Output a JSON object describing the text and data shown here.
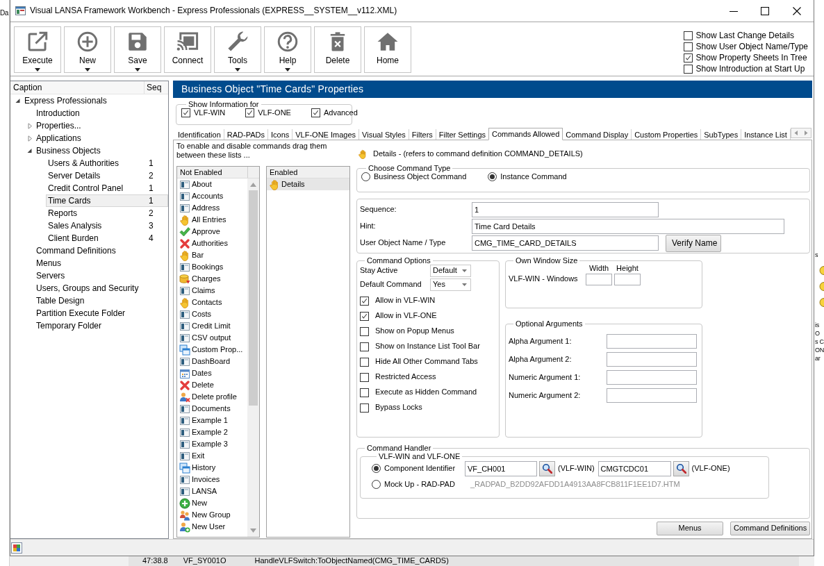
{
  "desktop": {
    "left_window_text": "Da",
    "right_window_fragments": [
      "s",
      "is",
      "O",
      "s C",
      "ON",
      "ar"
    ],
    "log_row": [
      "47:38.8",
      "VF_SY001O",
      "HandleVLFSwitch:ToObjectNamed(CMG_TIME_CARDS)"
    ]
  },
  "window": {
    "title": "Visual LANSA Framework Workbench - Express Professionals (EXPRESS__SYSTEM__v112.XML)"
  },
  "toolbar": [
    {
      "label": "Execute",
      "kind": "execute",
      "dropdown": true
    },
    {
      "label": "New",
      "kind": "new",
      "dropdown": true
    },
    {
      "label": "Save",
      "kind": "save",
      "dropdown": true
    },
    {
      "label": "Connect",
      "kind": "connect",
      "dropdown": false
    },
    {
      "label": "Tools",
      "kind": "tools",
      "dropdown": true
    },
    {
      "label": "Help",
      "kind": "help",
      "dropdown": true
    },
    {
      "label": "Delete",
      "kind": "delete",
      "dropdown": false
    },
    {
      "label": "Home",
      "kind": "home",
      "dropdown": false
    }
  ],
  "view_options": [
    {
      "label": "Show Last Change Details",
      "checked": false
    },
    {
      "label": "Show User Object Name/Type",
      "checked": false
    },
    {
      "label": "Show Property Sheets In Tree",
      "checked": true
    },
    {
      "label": "Show Introduction at Start Up",
      "checked": false
    }
  ],
  "tree": {
    "columns": [
      "Caption",
      "Seq"
    ],
    "items": [
      {
        "label": "Express Professionals",
        "expanded": true,
        "selected": false,
        "children": [
          {
            "label": "Introduction",
            "selected": false
          },
          {
            "label": "Properties...",
            "expanded": false,
            "selected": false
          },
          {
            "label": "Applications",
            "expanded": false,
            "selected": false
          },
          {
            "label": "Business Objects",
            "expanded": true,
            "selected": false,
            "children": [
              {
                "label": "Users & Authorities",
                "seq": "1",
                "selected": false
              },
              {
                "label": "Server Details",
                "seq": "2",
                "selected": false
              },
              {
                "label": "Credit Control Panel",
                "seq": "1",
                "selected": false
              },
              {
                "label": "Time Cards",
                "seq": "1",
                "selected": true
              },
              {
                "label": "Reports",
                "seq": "2",
                "selected": false
              },
              {
                "label": "Sales Analysis",
                "seq": "3",
                "selected": false
              },
              {
                "label": "Client Burden",
                "seq": "4",
                "selected": false
              }
            ]
          },
          {
            "label": "Command Definitions",
            "selected": false
          },
          {
            "label": "Menus",
            "selected": false
          },
          {
            "label": "Servers",
            "selected": false
          },
          {
            "label": "Users, Groups and Security",
            "selected": false
          },
          {
            "label": "Table Design",
            "selected": false
          },
          {
            "label": "Partition Execute Folder",
            "selected": false
          },
          {
            "label": "Temporary Folder",
            "selected": false
          }
        ]
      }
    ]
  },
  "panel": {
    "title": "Business Object \"Time Cards\" Properties",
    "show_information": {
      "legend": "Show Information for",
      "options": [
        {
          "label": "VLF-WIN",
          "checked": true
        },
        {
          "label": "VLF-ONE",
          "checked": true
        },
        {
          "label": "Advanced",
          "checked": true
        }
      ]
    },
    "tabs": [
      {
        "label": "Identification",
        "selected": false
      },
      {
        "label": "RAD-PADs",
        "selected": false
      },
      {
        "label": "Icons",
        "selected": false
      },
      {
        "label": "VLF-ONE Images",
        "selected": false
      },
      {
        "label": "Visual Styles",
        "selected": false
      },
      {
        "label": "Filters",
        "selected": false
      },
      {
        "label": "Filter Settings",
        "selected": false
      },
      {
        "label": "Commands Allowed",
        "selected": true
      },
      {
        "label": "Command Display",
        "selected": false
      },
      {
        "label": "Custom Properties",
        "selected": false
      },
      {
        "label": "SubTypes",
        "selected": false
      },
      {
        "label": "Instance List",
        "selected": false
      }
    ],
    "commands_allowed": {
      "instructions": "To enable and disable commands drag them between these lists ...",
      "not_enabled": {
        "header": "Not Enabled",
        "items": [
          {
            "label": "About",
            "kind": "window",
            "selected": false
          },
          {
            "label": "Accounts",
            "kind": "window",
            "selected": false
          },
          {
            "label": "Address",
            "kind": "window",
            "selected": false
          },
          {
            "label": "All Entries",
            "kind": "hand",
            "selected": false
          },
          {
            "label": "Approve",
            "kind": "check",
            "selected": false
          },
          {
            "label": "Authorities",
            "kind": "cross",
            "selected": false
          },
          {
            "label": "Bar",
            "kind": "hand",
            "selected": false
          },
          {
            "label": "Bookings",
            "kind": "window",
            "selected": false
          },
          {
            "label": "Charges",
            "kind": "coins",
            "selected": false
          },
          {
            "label": "Claims",
            "kind": "window",
            "selected": false
          },
          {
            "label": "Contacts",
            "kind": "hand",
            "selected": false
          },
          {
            "label": "Costs",
            "kind": "window",
            "selected": false
          },
          {
            "label": "Credit Limit",
            "kind": "window",
            "selected": false
          },
          {
            "label": "CSV output",
            "kind": "window",
            "selected": false
          },
          {
            "label": "Custom Prop...",
            "kind": "stack",
            "selected": false
          },
          {
            "label": "DashBoard",
            "kind": "window",
            "selected": false
          },
          {
            "label": "Dates",
            "kind": "calendar",
            "selected": false
          },
          {
            "label": "Delete",
            "kind": "cross",
            "selected": false
          },
          {
            "label": "Delete profile",
            "kind": "user-cross",
            "selected": false
          },
          {
            "label": "Documents",
            "kind": "window",
            "selected": false
          },
          {
            "label": "Example 1",
            "kind": "window",
            "selected": false
          },
          {
            "label": "Example 2",
            "kind": "window",
            "selected": false
          },
          {
            "label": "Example 3",
            "kind": "window",
            "selected": false
          },
          {
            "label": "Exit",
            "kind": "window",
            "selected": false
          },
          {
            "label": "History",
            "kind": "stack",
            "selected": false
          },
          {
            "label": "Invoices",
            "kind": "window",
            "selected": false
          },
          {
            "label": "LANSA",
            "kind": "window",
            "selected": false
          },
          {
            "label": "New",
            "kind": "plus",
            "selected": false
          },
          {
            "label": "New Group",
            "kind": "group",
            "selected": false
          },
          {
            "label": "New User",
            "kind": "user-plus",
            "selected": false
          }
        ]
      },
      "enabled": {
        "header": "Enabled",
        "items": [
          {
            "label": "Details",
            "kind": "hand",
            "selected": true
          }
        ]
      }
    },
    "command_detail": {
      "heading": "Details - (refers to command definition COMMAND_DETAILS)",
      "command_type": {
        "legend": "Choose Command Type",
        "options": [
          {
            "label": "Business Object Command",
            "selected": false
          },
          {
            "label": "Instance Command",
            "selected": true
          }
        ]
      },
      "fields": [
        {
          "label": "Sequence:",
          "value": "1"
        },
        {
          "label": "Hint:",
          "value": "Time Card Details"
        },
        {
          "label": "User Object Name / Type",
          "value": "CMG_TIME_CARD_DETAILS",
          "button": "Verify Name"
        }
      ],
      "command_options": {
        "legend": "Command Options",
        "dropdowns": [
          {
            "label": "Stay Active",
            "value": "Default"
          },
          {
            "label": "Default Command",
            "value": "Yes"
          }
        ],
        "checkboxes": [
          {
            "label": "Allow in VLF-WIN",
            "checked": true
          },
          {
            "label": "Allow in VLF-ONE",
            "checked": true
          },
          {
            "label": "Show on Popup Menus",
            "checked": false
          },
          {
            "label": "Show on Instance List Tool Bar",
            "checked": false
          },
          {
            "label": "Hide All Other Command Tabs",
            "checked": false
          },
          {
            "label": "Restricted Access",
            "checked": false
          },
          {
            "label": "Execute as Hidden Command",
            "checked": false
          },
          {
            "label": "Bypass Locks",
            "checked": false
          }
        ]
      },
      "own_window_size": {
        "legend": "Own Window Size",
        "columns": [
          "Width",
          "Height"
        ],
        "row_label": "VLF-WIN - Windows"
      },
      "optional_arguments": {
        "legend": "Optional Arguments",
        "fields": [
          "Alpha Argument 1:",
          "Alpha Argument 2:",
          "Numeric Argument 1:",
          "Numeric Argument 2:"
        ]
      },
      "command_handler": {
        "legend": "Command Handler",
        "inner_legend": "VLF-WIN and VLF-ONE",
        "options": [
          {
            "kind": "component",
            "label": "Component Identifier",
            "selected": true,
            "components": [
              {
                "value": "VF_CH001",
                "platform": "(VLF-WIN)"
              },
              {
                "value": "CMGTCDC01",
                "platform": "(VLF-ONE)"
              }
            ]
          },
          {
            "kind": "mockup",
            "label": "Mock Up - RAD-PAD",
            "selected": false,
            "file": "_RADPAD_B2DD92AFDD1A4913AA8FCB811F1EE1D7.HTM"
          }
        ]
      }
    },
    "buttons": [
      "Menus",
      "Command Definitions"
    ]
  }
}
